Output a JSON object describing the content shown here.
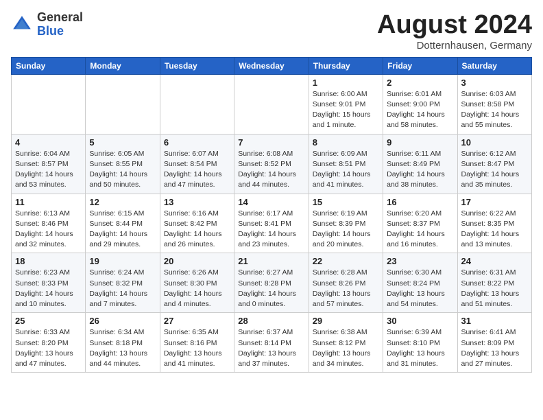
{
  "header": {
    "logo_general": "General",
    "logo_blue": "Blue",
    "month_title": "August 2024",
    "location": "Dotternhausen, Germany"
  },
  "weekdays": [
    "Sunday",
    "Monday",
    "Tuesday",
    "Wednesday",
    "Thursday",
    "Friday",
    "Saturday"
  ],
  "weeks": [
    [
      {
        "day": "",
        "info": ""
      },
      {
        "day": "",
        "info": ""
      },
      {
        "day": "",
        "info": ""
      },
      {
        "day": "",
        "info": ""
      },
      {
        "day": "1",
        "info": "Sunrise: 6:00 AM\nSunset: 9:01 PM\nDaylight: 15 hours\nand 1 minute."
      },
      {
        "day": "2",
        "info": "Sunrise: 6:01 AM\nSunset: 9:00 PM\nDaylight: 14 hours\nand 58 minutes."
      },
      {
        "day": "3",
        "info": "Sunrise: 6:03 AM\nSunset: 8:58 PM\nDaylight: 14 hours\nand 55 minutes."
      }
    ],
    [
      {
        "day": "4",
        "info": "Sunrise: 6:04 AM\nSunset: 8:57 PM\nDaylight: 14 hours\nand 53 minutes."
      },
      {
        "day": "5",
        "info": "Sunrise: 6:05 AM\nSunset: 8:55 PM\nDaylight: 14 hours\nand 50 minutes."
      },
      {
        "day": "6",
        "info": "Sunrise: 6:07 AM\nSunset: 8:54 PM\nDaylight: 14 hours\nand 47 minutes."
      },
      {
        "day": "7",
        "info": "Sunrise: 6:08 AM\nSunset: 8:52 PM\nDaylight: 14 hours\nand 44 minutes."
      },
      {
        "day": "8",
        "info": "Sunrise: 6:09 AM\nSunset: 8:51 PM\nDaylight: 14 hours\nand 41 minutes."
      },
      {
        "day": "9",
        "info": "Sunrise: 6:11 AM\nSunset: 8:49 PM\nDaylight: 14 hours\nand 38 minutes."
      },
      {
        "day": "10",
        "info": "Sunrise: 6:12 AM\nSunset: 8:47 PM\nDaylight: 14 hours\nand 35 minutes."
      }
    ],
    [
      {
        "day": "11",
        "info": "Sunrise: 6:13 AM\nSunset: 8:46 PM\nDaylight: 14 hours\nand 32 minutes."
      },
      {
        "day": "12",
        "info": "Sunrise: 6:15 AM\nSunset: 8:44 PM\nDaylight: 14 hours\nand 29 minutes."
      },
      {
        "day": "13",
        "info": "Sunrise: 6:16 AM\nSunset: 8:42 PM\nDaylight: 14 hours\nand 26 minutes."
      },
      {
        "day": "14",
        "info": "Sunrise: 6:17 AM\nSunset: 8:41 PM\nDaylight: 14 hours\nand 23 minutes."
      },
      {
        "day": "15",
        "info": "Sunrise: 6:19 AM\nSunset: 8:39 PM\nDaylight: 14 hours\nand 20 minutes."
      },
      {
        "day": "16",
        "info": "Sunrise: 6:20 AM\nSunset: 8:37 PM\nDaylight: 14 hours\nand 16 minutes."
      },
      {
        "day": "17",
        "info": "Sunrise: 6:22 AM\nSunset: 8:35 PM\nDaylight: 14 hours\nand 13 minutes."
      }
    ],
    [
      {
        "day": "18",
        "info": "Sunrise: 6:23 AM\nSunset: 8:33 PM\nDaylight: 14 hours\nand 10 minutes."
      },
      {
        "day": "19",
        "info": "Sunrise: 6:24 AM\nSunset: 8:32 PM\nDaylight: 14 hours\nand 7 minutes."
      },
      {
        "day": "20",
        "info": "Sunrise: 6:26 AM\nSunset: 8:30 PM\nDaylight: 14 hours\nand 4 minutes."
      },
      {
        "day": "21",
        "info": "Sunrise: 6:27 AM\nSunset: 8:28 PM\nDaylight: 14 hours\nand 0 minutes."
      },
      {
        "day": "22",
        "info": "Sunrise: 6:28 AM\nSunset: 8:26 PM\nDaylight: 13 hours\nand 57 minutes."
      },
      {
        "day": "23",
        "info": "Sunrise: 6:30 AM\nSunset: 8:24 PM\nDaylight: 13 hours\nand 54 minutes."
      },
      {
        "day": "24",
        "info": "Sunrise: 6:31 AM\nSunset: 8:22 PM\nDaylight: 13 hours\nand 51 minutes."
      }
    ],
    [
      {
        "day": "25",
        "info": "Sunrise: 6:33 AM\nSunset: 8:20 PM\nDaylight: 13 hours\nand 47 minutes."
      },
      {
        "day": "26",
        "info": "Sunrise: 6:34 AM\nSunset: 8:18 PM\nDaylight: 13 hours\nand 44 minutes."
      },
      {
        "day": "27",
        "info": "Sunrise: 6:35 AM\nSunset: 8:16 PM\nDaylight: 13 hours\nand 41 minutes."
      },
      {
        "day": "28",
        "info": "Sunrise: 6:37 AM\nSunset: 8:14 PM\nDaylight: 13 hours\nand 37 minutes."
      },
      {
        "day": "29",
        "info": "Sunrise: 6:38 AM\nSunset: 8:12 PM\nDaylight: 13 hours\nand 34 minutes."
      },
      {
        "day": "30",
        "info": "Sunrise: 6:39 AM\nSunset: 8:10 PM\nDaylight: 13 hours\nand 31 minutes."
      },
      {
        "day": "31",
        "info": "Sunrise: 6:41 AM\nSunset: 8:09 PM\nDaylight: 13 hours\nand 27 minutes."
      }
    ]
  ]
}
